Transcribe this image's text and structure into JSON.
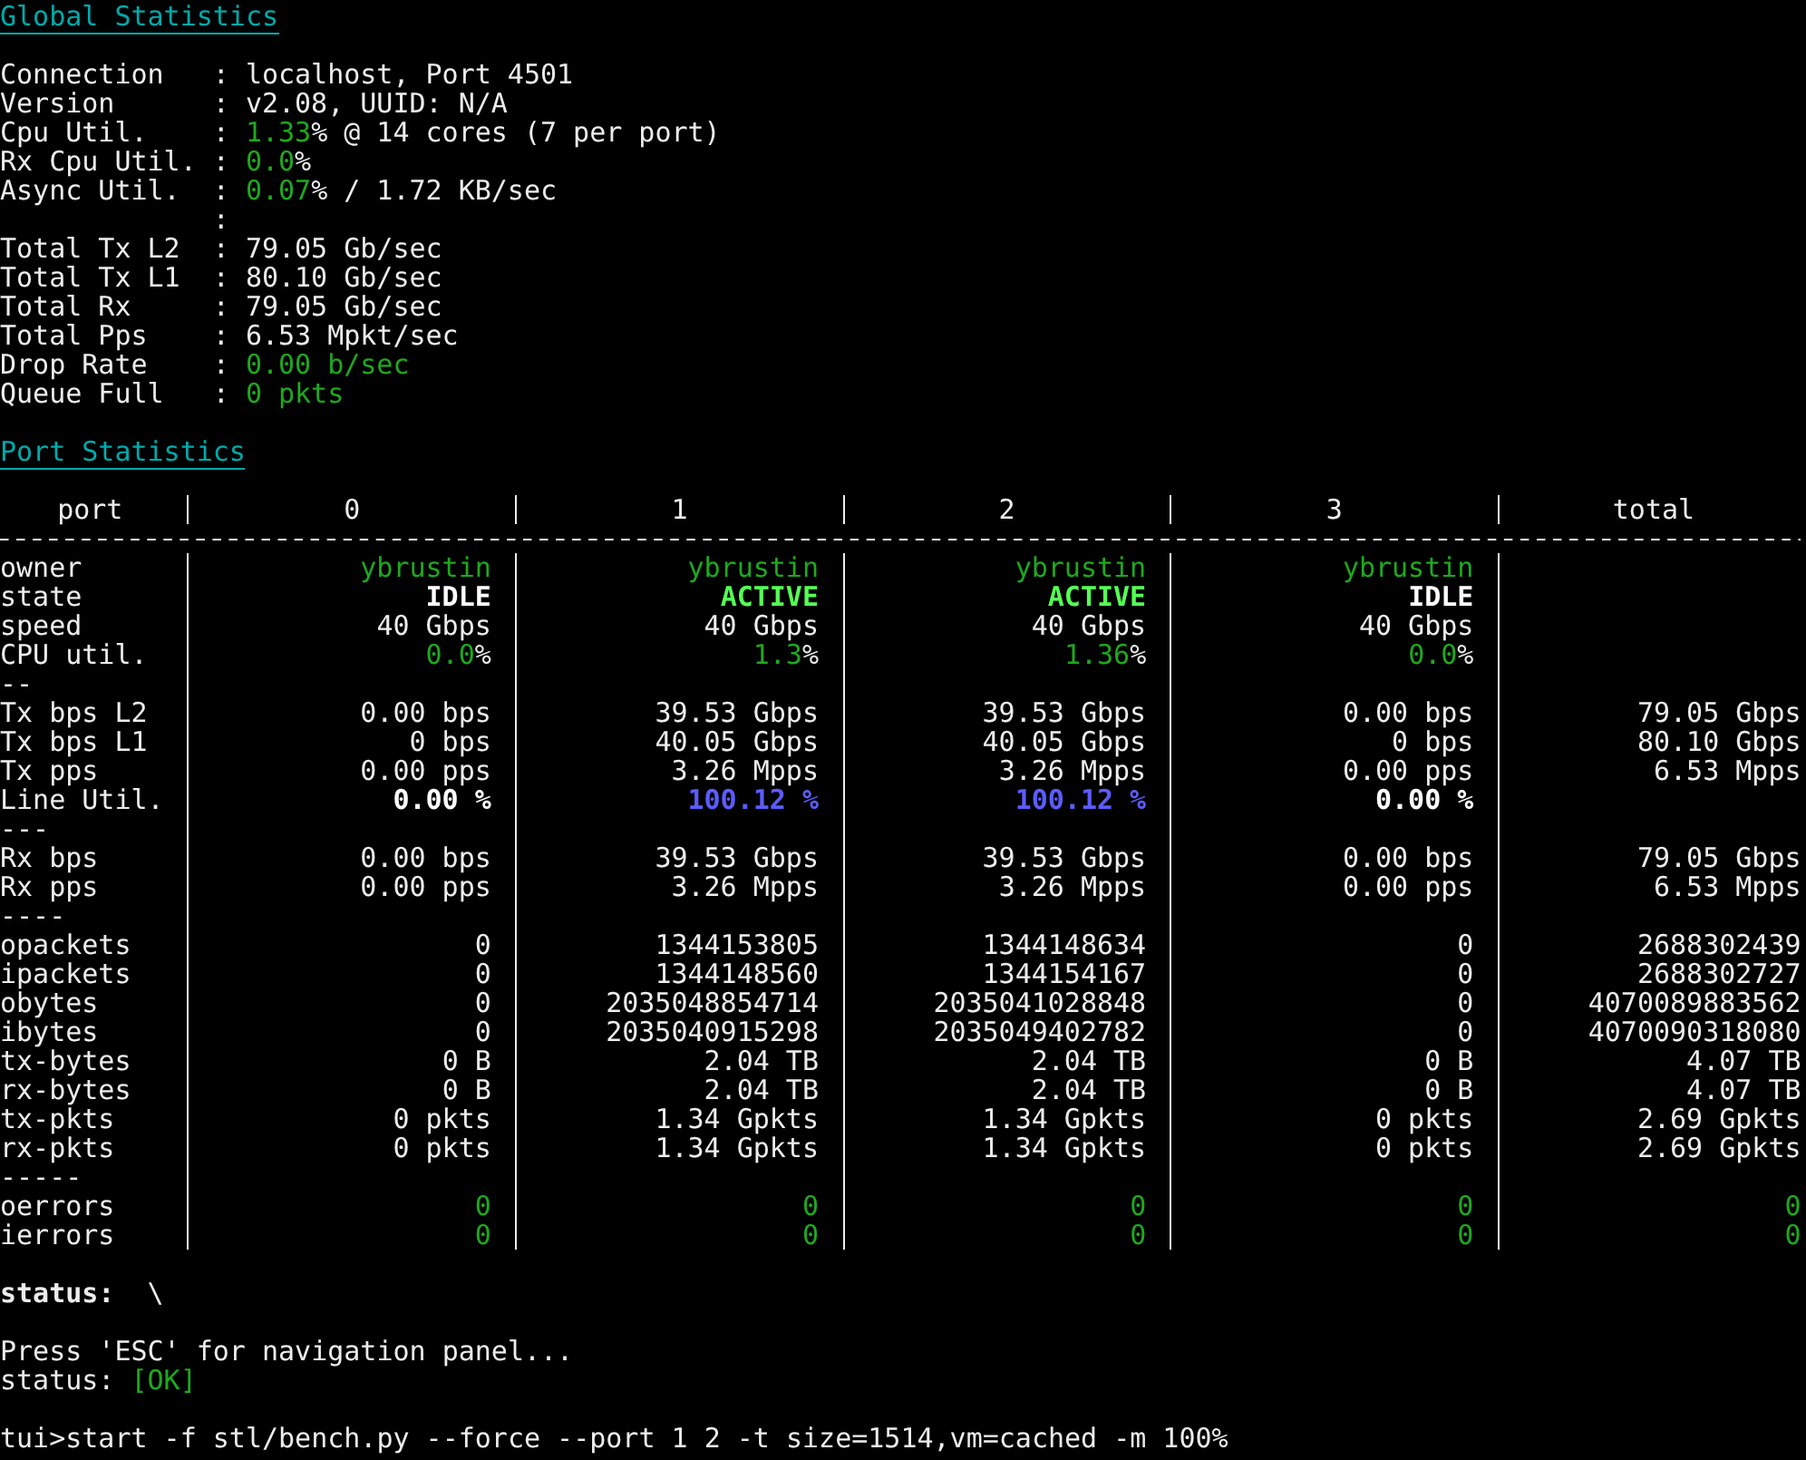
{
  "global_statistics": {
    "title": "Global Statistics",
    "rows": [
      {
        "label": "Connection",
        "sep": ":",
        "parts": [
          {
            "text": "localhost, Port 4501",
            "kind": "plain"
          }
        ]
      },
      {
        "label": "Version",
        "sep": ":",
        "parts": [
          {
            "text": "v2.08, UUID: N/A",
            "kind": "plain"
          }
        ]
      },
      {
        "label": "Cpu Util.",
        "sep": ":",
        "parts": [
          {
            "text": "1.33",
            "kind": "green"
          },
          {
            "text": "% @ 14 cores (7 per port)",
            "kind": "plain"
          }
        ]
      },
      {
        "label": "Rx Cpu Util.",
        "sep": ":",
        "parts": [
          {
            "text": "0.0",
            "kind": "green"
          },
          {
            "text": "%",
            "kind": "plain"
          }
        ]
      },
      {
        "label": "Async Util.",
        "sep": ":",
        "parts": [
          {
            "text": "0.07",
            "kind": "green"
          },
          {
            "text": "% / 1.72 KB/sec",
            "kind": "plain"
          }
        ]
      },
      {
        "sep": ":"
      },
      {
        "label": "Total Tx L2",
        "sep": ":",
        "parts": [
          {
            "text": "79.05 Gb/sec",
            "kind": "plain"
          }
        ]
      },
      {
        "label": "Total Tx L1",
        "sep": ":",
        "parts": [
          {
            "text": "80.10 Gb/sec",
            "kind": "plain"
          }
        ]
      },
      {
        "label": "Total Rx",
        "sep": ":",
        "parts": [
          {
            "text": "79.05 Gb/sec",
            "kind": "plain"
          }
        ]
      },
      {
        "label": "Total Pps",
        "sep": ":",
        "parts": [
          {
            "text": "6.53 Mpkt/sec",
            "kind": "plain"
          }
        ]
      },
      {
        "label": "Drop Rate",
        "sep": ":",
        "parts": [
          {
            "text": "0.00 b/sec",
            "kind": "green"
          }
        ]
      },
      {
        "label": "Queue Full",
        "sep": ":",
        "parts": [
          {
            "text": "0 pkts",
            "kind": "green"
          }
        ]
      }
    ]
  },
  "port_statistics": {
    "title": "Port Statistics",
    "columns": [
      "port",
      "0",
      "1",
      "2",
      "3",
      "total"
    ],
    "rows": [
      {
        "label": "owner",
        "cells": [
          {
            "text": "ybrustin",
            "kind": "green"
          },
          {
            "text": "ybrustin",
            "kind": "green"
          },
          {
            "text": "ybrustin",
            "kind": "green"
          },
          {
            "text": "ybrustin",
            "kind": "green"
          }
        ]
      },
      {
        "label": "state",
        "cells": [
          {
            "text": "IDLE",
            "kind": "idle"
          },
          {
            "text": "ACTIVE",
            "kind": "active"
          },
          {
            "text": "ACTIVE",
            "kind": "active"
          },
          {
            "text": "IDLE",
            "kind": "idle"
          }
        ]
      },
      {
        "label": "speed",
        "cells": [
          {
            "text": "40 Gbps",
            "kind": "plain"
          },
          {
            "text": "40 Gbps",
            "kind": "plain"
          },
          {
            "text": "40 Gbps",
            "kind": "plain"
          },
          {
            "text": "40 Gbps",
            "kind": "plain"
          }
        ]
      },
      {
        "label": "CPU util.",
        "cells": [
          {
            "text": "0.0",
            "unit": "%",
            "kind": "pct"
          },
          {
            "text": "1.3",
            "unit": "%",
            "kind": "pct"
          },
          {
            "text": "1.36",
            "unit": "%",
            "kind": "pct"
          },
          {
            "text": "0.0",
            "unit": "%",
            "kind": "pct"
          }
        ]
      },
      {
        "label": "--"
      },
      {
        "label": "Tx bps L2",
        "cells": [
          {
            "text": "0.00 bps",
            "kind": "plain"
          },
          {
            "text": "39.53 Gbps",
            "kind": "plain"
          },
          {
            "text": "39.53 Gbps",
            "kind": "plain"
          },
          {
            "text": "0.00 bps",
            "kind": "plain"
          },
          {
            "text": "79.05 Gbps",
            "kind": "plain"
          }
        ]
      },
      {
        "label": "Tx bps L1",
        "cells": [
          {
            "text": "0 bps",
            "kind": "plain"
          },
          {
            "text": "40.05 Gbps",
            "kind": "plain"
          },
          {
            "text": "40.05 Gbps",
            "kind": "plain"
          },
          {
            "text": "0 bps",
            "kind": "plain"
          },
          {
            "text": "80.10 Gbps",
            "kind": "plain"
          }
        ]
      },
      {
        "label": "Tx pps",
        "cells": [
          {
            "text": "0.00 pps",
            "kind": "plain"
          },
          {
            "text": "3.26 Mpps",
            "kind": "plain"
          },
          {
            "text": "3.26 Mpps",
            "kind": "plain"
          },
          {
            "text": "0.00 pps",
            "kind": "plain"
          },
          {
            "text": "6.53 Mpps",
            "kind": "plain"
          }
        ]
      },
      {
        "label": "Line Util.",
        "cells": [
          {
            "text": "0.00 %",
            "kind": "util_low"
          },
          {
            "text": "100.12 %",
            "kind": "util_high"
          },
          {
            "text": "100.12 %",
            "kind": "util_high"
          },
          {
            "text": "0.00 %",
            "kind": "util_low"
          }
        ]
      },
      {
        "label": "---"
      },
      {
        "label": "Rx bps",
        "cells": [
          {
            "text": "0.00 bps",
            "kind": "plain"
          },
          {
            "text": "39.53 Gbps",
            "kind": "plain"
          },
          {
            "text": "39.53 Gbps",
            "kind": "plain"
          },
          {
            "text": "0.00 bps",
            "kind": "plain"
          },
          {
            "text": "79.05 Gbps",
            "kind": "plain"
          }
        ]
      },
      {
        "label": "Rx pps",
        "cells": [
          {
            "text": "0.00 pps",
            "kind": "plain"
          },
          {
            "text": "3.26 Mpps",
            "kind": "plain"
          },
          {
            "text": "3.26 Mpps",
            "kind": "plain"
          },
          {
            "text": "0.00 pps",
            "kind": "plain"
          },
          {
            "text": "6.53 Mpps",
            "kind": "plain"
          }
        ]
      },
      {
        "label": "----"
      },
      {
        "label": "opackets",
        "cells": [
          {
            "text": "0",
            "kind": "plain"
          },
          {
            "text": "1344153805",
            "kind": "plain"
          },
          {
            "text": "1344148634",
            "kind": "plain"
          },
          {
            "text": "0",
            "kind": "plain"
          },
          {
            "text": "2688302439",
            "kind": "plain"
          }
        ]
      },
      {
        "label": "ipackets",
        "cells": [
          {
            "text": "0",
            "kind": "plain"
          },
          {
            "text": "1344148560",
            "kind": "plain"
          },
          {
            "text": "1344154167",
            "kind": "plain"
          },
          {
            "text": "0",
            "kind": "plain"
          },
          {
            "text": "2688302727",
            "kind": "plain"
          }
        ]
      },
      {
        "label": "obytes",
        "cells": [
          {
            "text": "0",
            "kind": "plain"
          },
          {
            "text": "2035048854714",
            "kind": "plain"
          },
          {
            "text": "2035041028848",
            "kind": "plain"
          },
          {
            "text": "0",
            "kind": "plain"
          },
          {
            "text": "4070089883562",
            "kind": "plain"
          }
        ]
      },
      {
        "label": "ibytes",
        "cells": [
          {
            "text": "0",
            "kind": "plain"
          },
          {
            "text": "2035040915298",
            "kind": "plain"
          },
          {
            "text": "2035049402782",
            "kind": "plain"
          },
          {
            "text": "0",
            "kind": "plain"
          },
          {
            "text": "4070090318080",
            "kind": "plain"
          }
        ]
      },
      {
        "label": "tx-bytes",
        "cells": [
          {
            "text": "0 B",
            "kind": "plain"
          },
          {
            "text": "2.04 TB",
            "kind": "plain"
          },
          {
            "text": "2.04 TB",
            "kind": "plain"
          },
          {
            "text": "0 B",
            "kind": "plain"
          },
          {
            "text": "4.07 TB",
            "kind": "plain"
          }
        ]
      },
      {
        "label": "rx-bytes",
        "cells": [
          {
            "text": "0 B",
            "kind": "plain"
          },
          {
            "text": "2.04 TB",
            "kind": "plain"
          },
          {
            "text": "2.04 TB",
            "kind": "plain"
          },
          {
            "text": "0 B",
            "kind": "plain"
          },
          {
            "text": "4.07 TB",
            "kind": "plain"
          }
        ]
      },
      {
        "label": "tx-pkts",
        "cells": [
          {
            "text": "0 pkts",
            "kind": "plain"
          },
          {
            "text": "1.34 Gpkts",
            "kind": "plain"
          },
          {
            "text": "1.34 Gpkts",
            "kind": "plain"
          },
          {
            "text": "0 pkts",
            "kind": "plain"
          },
          {
            "text": "2.69 Gpkts",
            "kind": "plain"
          }
        ]
      },
      {
        "label": "rx-pkts",
        "cells": [
          {
            "text": "0 pkts",
            "kind": "plain"
          },
          {
            "text": "1.34 Gpkts",
            "kind": "plain"
          },
          {
            "text": "1.34 Gpkts",
            "kind": "plain"
          },
          {
            "text": "0 pkts",
            "kind": "plain"
          },
          {
            "text": "2.69 Gpkts",
            "kind": "plain"
          }
        ]
      },
      {
        "label": "-----"
      },
      {
        "label": "oerrors",
        "cells": [
          {
            "text": "0",
            "kind": "green"
          },
          {
            "text": "0",
            "kind": "green"
          },
          {
            "text": "0",
            "kind": "green"
          },
          {
            "text": "0",
            "kind": "green"
          },
          {
            "text": "0",
            "kind": "green"
          }
        ]
      },
      {
        "label": "ierrors",
        "cells": [
          {
            "text": "0",
            "kind": "green"
          },
          {
            "text": "0",
            "kind": "green"
          },
          {
            "text": "0",
            "kind": "green"
          },
          {
            "text": "0",
            "kind": "green"
          },
          {
            "text": "0",
            "kind": "green"
          }
        ]
      }
    ]
  },
  "status_line": {
    "label": "status:",
    "spinner": "\\"
  },
  "console": {
    "hint": "Press 'ESC' for navigation panel...",
    "status_label": "status:",
    "status_value": "[OK]",
    "command": "tui>start -f stl/bench.py --force --port 1 2 -t size=1514,vm=cached -m 100%"
  }
}
